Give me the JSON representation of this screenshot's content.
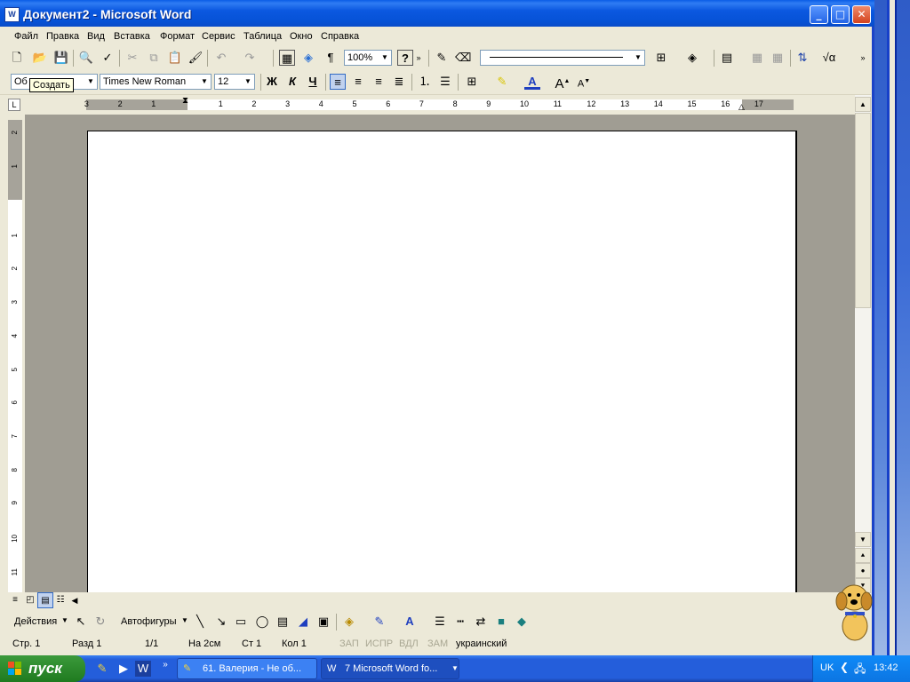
{
  "window": {
    "title": "Документ2 - Microsoft Word",
    "app_icon_label": "W"
  },
  "window_controls": {
    "minimize": "_",
    "maximize": "□",
    "close": "✕"
  },
  "menu": [
    "Файл",
    "Правка",
    "Вид",
    "Вставка",
    "Формат",
    "Сервис",
    "Таблица",
    "Окно",
    "Справка"
  ],
  "standard_toolbar": {
    "zoom": "100%",
    "icons": [
      "new-icon",
      "open-icon",
      "save-icon",
      "print-preview-icon",
      "spelling-icon",
      "cut-icon",
      "copy-icon",
      "paste-icon",
      "format-painter-icon",
      "undo-icon",
      "redo-icon",
      "document-map-icon",
      "web-icon",
      "show-paragraph-icon",
      "help-icon",
      "pen-icon",
      "eraser-icon",
      "border-icon",
      "shading-icon",
      "table-icon",
      "sort-icon",
      "equation-icon"
    ],
    "paragraph_mark": "¶",
    "help_mark": "?"
  },
  "formatting_toolbar": {
    "style": "Обычный",
    "style_visible": "Об",
    "font": "Times New Roman",
    "size": "12",
    "bold": "Ж",
    "italic": "К",
    "underline": "Ч",
    "font_color_letter": "A"
  },
  "tooltip": "Создать",
  "ruler": {
    "numbers": [
      "3",
      "2",
      "1",
      "1",
      "2",
      "3",
      "4",
      "5",
      "6",
      "7",
      "8",
      "9",
      "10",
      "11",
      "12",
      "13",
      "14",
      "15",
      "16",
      "17"
    ]
  },
  "vertical_ruler": {
    "numbers": [
      "2",
      "1",
      "1",
      "2",
      "3",
      "4",
      "5",
      "6",
      "7",
      "8",
      "9",
      "10",
      "11"
    ]
  },
  "drawing_toolbar": {
    "actions": "Действия",
    "autoshapes": "Автофигуры"
  },
  "status_bar": {
    "page": "Стр. 1",
    "section": "Разд 1",
    "pages": "1/1",
    "at": "На 2см",
    "line": "Ст 1",
    "col": "Кол 1",
    "rec": "ЗАП",
    "trk": "ИСПР",
    "ext": "ВДЛ",
    "ovr": "ЗАМ",
    "language": "украинский"
  },
  "taskbar": {
    "start": "пуск",
    "tasks": [
      "61. Валерия - Не об...",
      "7 Microsoft Word fo..."
    ],
    "language": "UK",
    "clock": "13:42"
  }
}
